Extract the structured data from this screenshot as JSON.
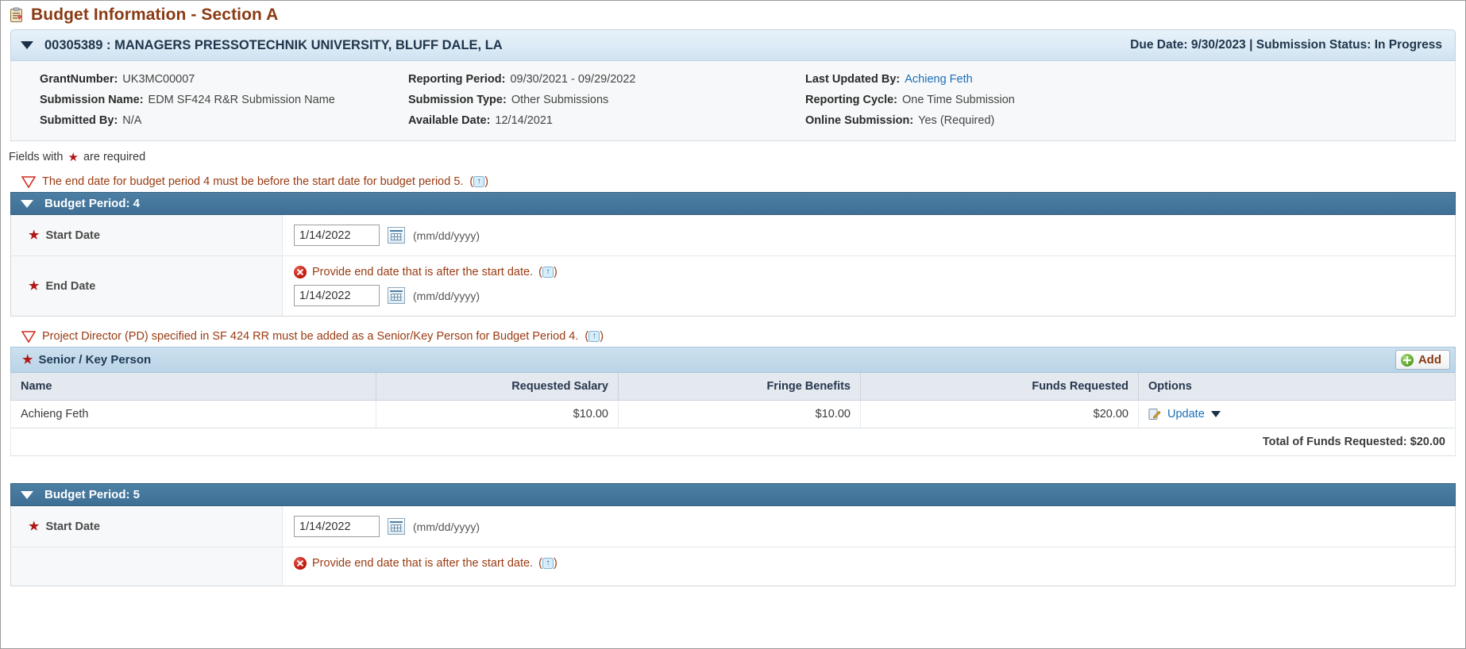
{
  "page": {
    "title": "Budget Information - Section A",
    "title_icon": "clipboard-checklist-icon"
  },
  "banner": {
    "collapse_icon": "triangle-down-icon",
    "grant_heading": "00305389 : MANAGERS PRESSOTECHNIK UNIVERSITY, BLUFF DALE, LA",
    "status_summary": "Due Date: 9/30/2023 | Submission Status: In Progress"
  },
  "metadata": {
    "rows": [
      [
        {
          "label": "GrantNumber:",
          "value": "UK3MC00007",
          "link": false
        },
        {
          "label": "Reporting Period:",
          "value": "09/30/2021 - 09/29/2022",
          "link": false
        },
        {
          "label": "Last Updated By:",
          "value": "Achieng Feth",
          "link": true
        }
      ],
      [
        {
          "label": "Submission Name:",
          "value": "EDM SF424 R&R Submission Name",
          "link": false
        },
        {
          "label": "Submission Type:",
          "value": "Other Submissions",
          "link": false
        },
        {
          "label": "Reporting Cycle:",
          "value": "One Time Submission",
          "link": false
        }
      ],
      [
        {
          "label": "Submitted By:",
          "value": "N/A",
          "link": false
        },
        {
          "label": "Available Date:",
          "value": "12/14/2021",
          "link": false
        },
        {
          "label": "Online Submission:",
          "value": "Yes (Required)",
          "link": false
        }
      ]
    ]
  },
  "required_note": {
    "prefix": "Fields with",
    "star": "★",
    "suffix": "are required"
  },
  "errors": {
    "period4_date_order": "The end date for budget period 4 must be before the start date for budget period 5.",
    "period4_pd_missing": "Project Director (PD) specified in SF 424 RR must be added as a Senior/Key Person for Budget Period 4.",
    "end_date_inline": "Provide end date that is after the start date.",
    "info_glyph": "↑"
  },
  "budget_period_4": {
    "header": "Budget Period: 4",
    "start_date": {
      "label": "Start Date",
      "value": "1/14/2022",
      "placeholder": "mm/dd/yyyy",
      "hint": "(mm/dd/yyyy)",
      "calendar_icon": "calendar-icon"
    },
    "end_date": {
      "label": "End Date",
      "value": "1/14/2022",
      "placeholder": "mm/dd/yyyy",
      "hint": "(mm/dd/yyyy)",
      "calendar_icon": "calendar-icon"
    }
  },
  "senior_key_person": {
    "section_title": "Senior / Key Person",
    "add_label": "Add",
    "columns": [
      "Name",
      "Requested Salary",
      "Fringe Benefits",
      "Funds Requested",
      "Options"
    ],
    "rows": [
      {
        "name": "Achieng Feth",
        "requested_salary": "$10.00",
        "fringe_benefits": "$10.00",
        "funds_requested": "$20.00",
        "option_label": "Update"
      }
    ],
    "total_label": "Total of Funds Requested: $20.00"
  },
  "budget_period_5": {
    "header": "Budget Period: 5",
    "start_date": {
      "label": "Start Date",
      "value": "1/14/2022",
      "placeholder": "mm/dd/yyyy",
      "hint": "(mm/dd/yyyy)",
      "calendar_icon": "calendar-icon"
    },
    "end_date_error": "Provide end date that is after the start date."
  },
  "colors": {
    "title": "#8a3a12",
    "banner_text": "#20364c",
    "section_header": "#44769c",
    "error_text": "#9a3b12",
    "link": "#1c6fb8",
    "required_star": "#b01717"
  }
}
